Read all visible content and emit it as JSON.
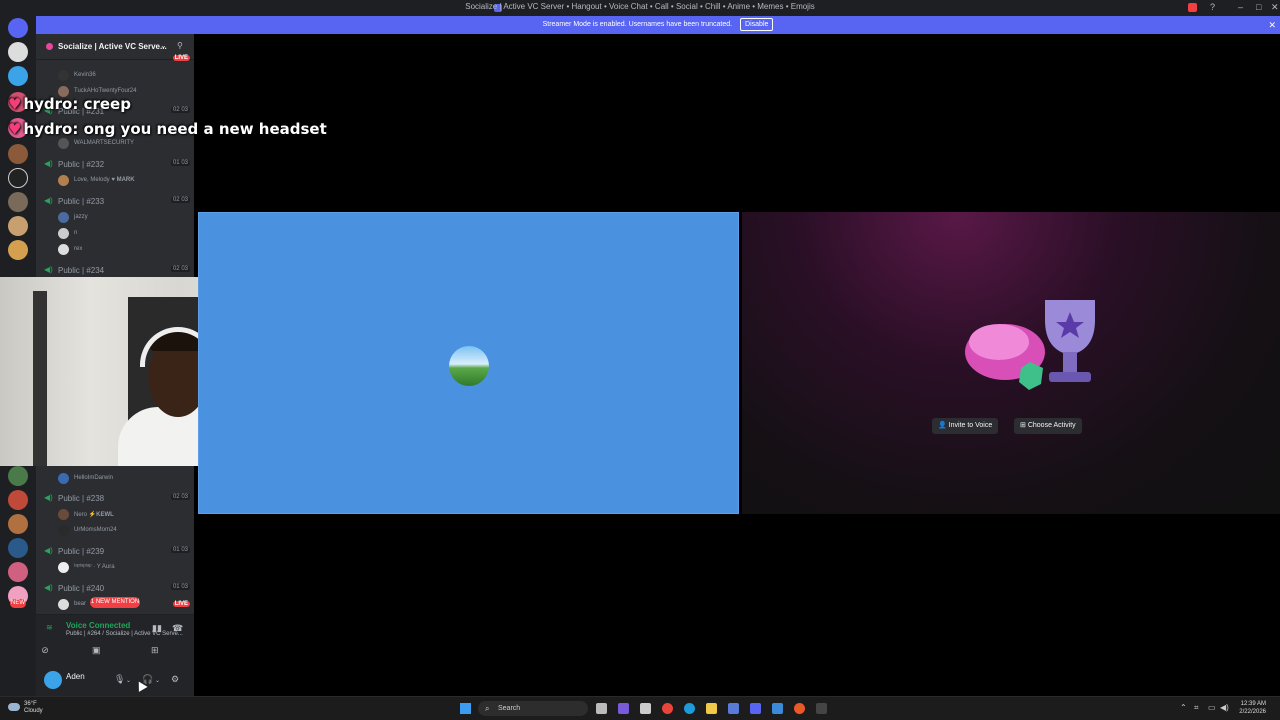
{
  "window": {
    "title": "Socialize | Active VC Server • Hangout • Voice Chat • Call • Social • Chill • Anime • Memes • Emojis"
  },
  "banner": {
    "text": "Streamer Mode is enabled. Usernames have been truncated.",
    "disable_label": "Disable"
  },
  "rail": {
    "badges": [
      "148",
      "NEW"
    ]
  },
  "server": {
    "name": "Socialize | Active VC Serve..."
  },
  "channels": [
    {
      "label": "Public | #231",
      "counts": [
        "02",
        "03"
      ]
    },
    {
      "label": "Public | #232",
      "counts": [
        "01",
        "03"
      ]
    },
    {
      "label": "Public | #233",
      "counts": [
        "02",
        "03"
      ]
    },
    {
      "label": "Public | #234",
      "counts": [
        "02",
        "03"
      ]
    },
    {
      "label": "Public | #238",
      "counts": [
        "02",
        "03"
      ]
    },
    {
      "label": "Public | #239",
      "counts": [
        "01",
        "03"
      ]
    },
    {
      "label": "Public | #240",
      "counts": [
        "01",
        "03"
      ]
    }
  ],
  "users": {
    "kevin": "Kevin36",
    "tuck": "TuckAHoTwentyFour24",
    "walmart": "WALMARTSECURITY",
    "love": "Love, Melody",
    "love_tag": "MARK",
    "jazzy": "jazzy",
    "n": "n",
    "rex": "rex",
    "hello": "HelloImDarwin",
    "nero": "Nero",
    "nero_tag": "KEWL",
    "urmoms": "UrMomsMom24",
    "aura_user": "ᵗᵃᵖᵗᵃᵖᵗᵃᵖ",
    "aura_tag": "Aura",
    "bear": "bear"
  },
  "live_label": "LIVE",
  "mention_label": "1 NEW MENTION",
  "chat": [
    {
      "nick": "hydro",
      "text": "creep"
    },
    {
      "nick": "hydro",
      "text": "ong you need a new headset"
    }
  ],
  "voice": {
    "status": "Voice Connected",
    "channel": "Public | #264 / Socialize | Active VC Serve..."
  },
  "user": {
    "name": "Aden"
  },
  "activity": {
    "invite_label": "Invite to Voice",
    "choose_label": "Choose Activity"
  },
  "taskbar": {
    "weather_temp": "36°F",
    "weather_desc": "Cloudy",
    "search_label": "Search",
    "time": "12:39 AM",
    "date": "2/22/2026"
  },
  "colors": {
    "blurple": "#5865f2",
    "voice_green": "#23a55a",
    "live_red": "#f23f43",
    "tile_blue": "#4a92e0"
  }
}
